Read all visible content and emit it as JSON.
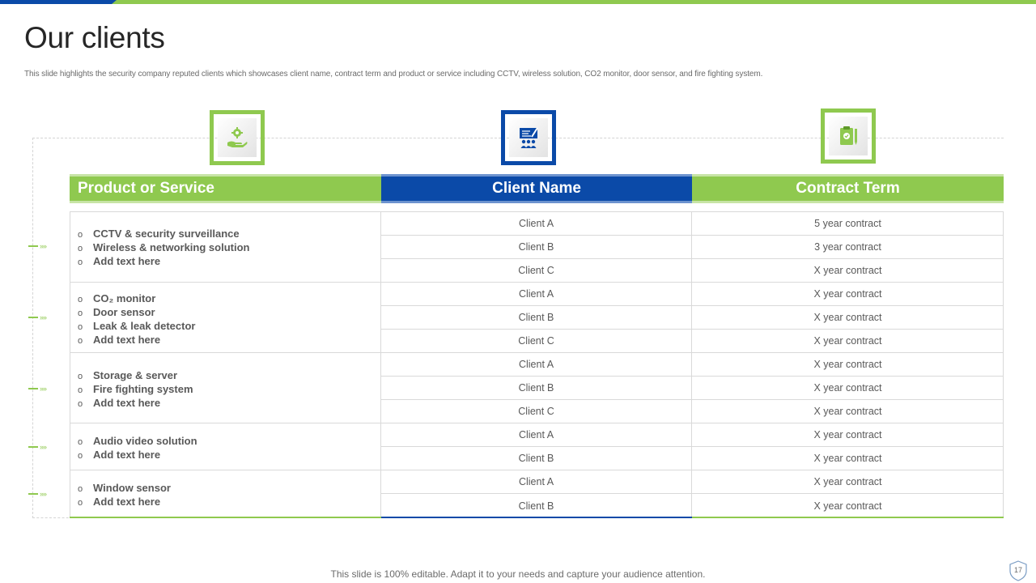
{
  "title": "Our clients",
  "subtitle": "This slide highlights the security company reputed clients which showcases client name, contract term and product or service including CCTV,  wireless solution, CO2 monitor,  door sensor, and fire fighting system.",
  "columns": {
    "product": "Product or Service",
    "client": "Client Name",
    "term": "Contract Term"
  },
  "icons": [
    "hand-gear-icon",
    "presentation-team-icon",
    "clipboard-pen-icon"
  ],
  "bullet": "o",
  "groups": [
    {
      "items": [
        "CCTV & security  surveillance",
        "Wireless & networking solution",
        "Add text here"
      ]
    },
    {
      "items": [
        "CO₂ monitor",
        "Door sensor",
        "Leak & leak detector",
        "Add text here"
      ]
    },
    {
      "items": [
        "Storage & server",
        "Fire fighting system",
        "Add text here"
      ]
    },
    {
      "items": [
        "Audio video solution",
        "Add text here"
      ]
    },
    {
      "items": [
        "Window sensor",
        "Add text here"
      ]
    }
  ],
  "rows": [
    {
      "client": "Client A",
      "term": "5 year contract"
    },
    {
      "client": "Client B",
      "term": "3 year contract"
    },
    {
      "client": "Client C",
      "term": "X year contract"
    },
    {
      "client": "Client A",
      "term": "X year contract"
    },
    {
      "client": "Client B",
      "term": "X year contract"
    },
    {
      "client": "Client C",
      "term": "X year contract"
    },
    {
      "client": "Client A",
      "term": "X year contract"
    },
    {
      "client": "Client B",
      "term": "X year contract"
    },
    {
      "client": "Client C",
      "term": "X year contract"
    },
    {
      "client": "Client A",
      "term": "X year contract"
    },
    {
      "client": "Client B",
      "term": "X year contract"
    },
    {
      "client": "Client A",
      "term": "X year contract"
    },
    {
      "client": "Client B",
      "term": "X year contract"
    }
  ],
  "connector_glyph": "››››",
  "footer": "This slide is 100% editable. Adapt it to your  needs and capture your audience attention.",
  "page_number": "17",
  "colors": {
    "green": "#8fc94f",
    "blue": "#0b4aa8"
  }
}
